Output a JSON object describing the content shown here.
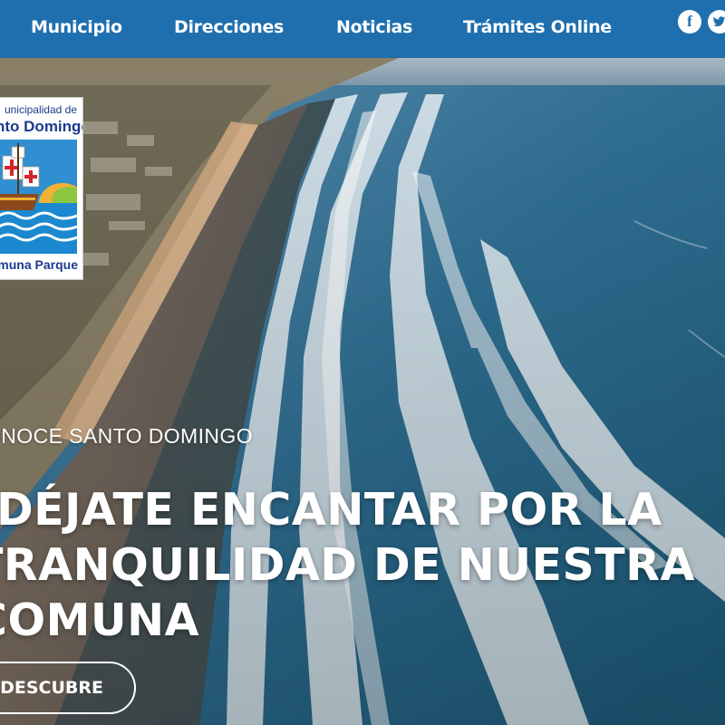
{
  "nav": {
    "items": [
      {
        "label": "Municipio"
      },
      {
        "label": "Direcciones"
      },
      {
        "label": "Noticias"
      },
      {
        "label": "Trámites Online"
      }
    ],
    "social": {
      "facebook": "f",
      "twitter": "t"
    },
    "bg_color": "#1f6fae"
  },
  "logo": {
    "top_text": "unicipalidad de",
    "name": "nto Domingo",
    "bottom_text": "muna Parque"
  },
  "hero": {
    "eyebrow": "CONOCE SANTO DOMINGO",
    "headline": [
      "DÉJATE ENCANTAR POR LA",
      "TRANQUILIDAD DE NUESTRA",
      "COMUNA"
    ],
    "cta_label": "DESCUBRE"
  },
  "icons": [
    "facebook-icon",
    "twitter-icon"
  ]
}
